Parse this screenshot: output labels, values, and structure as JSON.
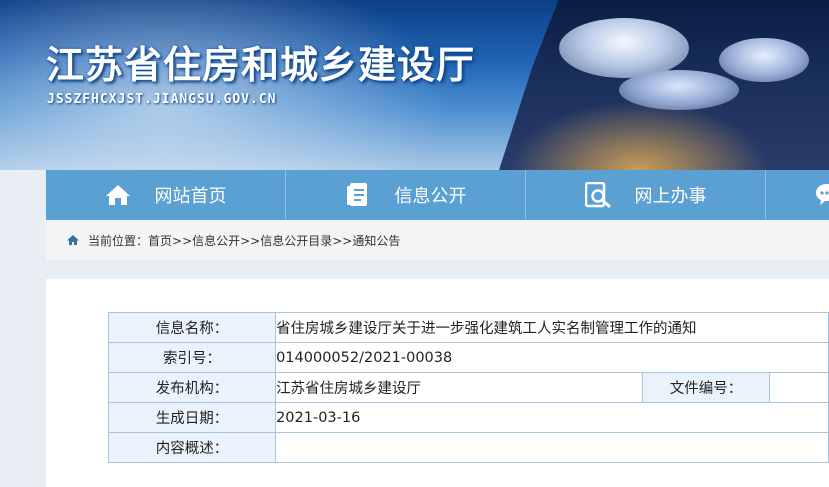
{
  "header": {
    "title": "江苏省住房和城乡建设厅",
    "url": "JSSZFHCXJST.JIANGSU.GOV.CN"
  },
  "nav": {
    "items": [
      {
        "label": "网站首页",
        "icon": "home-icon"
      },
      {
        "label": "信息公开",
        "icon": "document-icon"
      },
      {
        "label": "网上办事",
        "icon": "search-document-icon"
      },
      {
        "label": "",
        "icon": "chat-icon"
      }
    ]
  },
  "breadcrumb": {
    "prefix": "当前位置：",
    "path": "首页>>信息公开>>信息公开目录>>通知公告"
  },
  "info": {
    "name_label": "信息名称：",
    "name_value": "省住房城乡建设厅关于进一步强化建筑工人实名制管理工作的通知",
    "index_label": "索引号：",
    "index_value": "014000052/2021-00038",
    "org_label": "发布机构：",
    "org_value": "江苏省住房城乡建设厅",
    "docno_label": "文件编号：",
    "docno_value": "",
    "date_label": "生成日期：",
    "date_value": "2021-03-16",
    "summary_label": "内容概述：",
    "summary_value": ""
  },
  "colors": {
    "nav_bg": "#5aa0d3",
    "label_bg": "#eaf3fc",
    "border": "#a8c3de"
  }
}
